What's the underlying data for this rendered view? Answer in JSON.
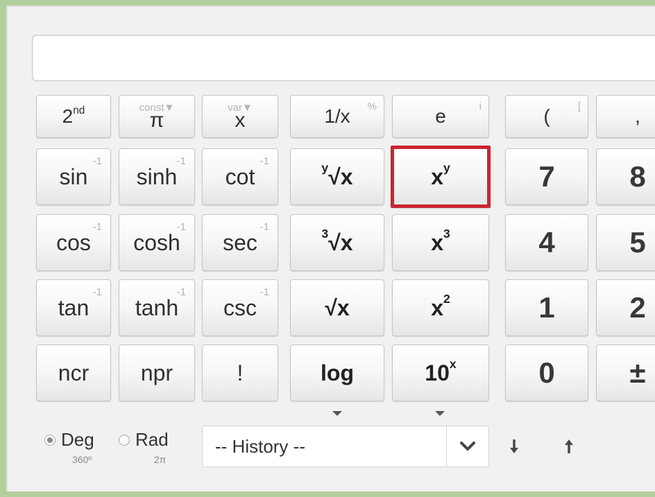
{
  "display": {
    "value": ""
  },
  "keys": {
    "second": {
      "label": "2",
      "sup": "nd"
    },
    "const": {
      "hint": "const▼",
      "label": "π"
    },
    "var": {
      "hint": "var▼",
      "label": "x"
    },
    "reciprocal": {
      "label": "1/x",
      "hint": "%"
    },
    "e": {
      "label": "e",
      "hint": "i"
    },
    "paren_open": {
      "label": "(",
      "hint": "["
    },
    "comma": {
      "label": ","
    },
    "sin": {
      "label": "sin",
      "hint": "-1"
    },
    "sinh": {
      "label": "sinh",
      "hint": "-1"
    },
    "cot": {
      "label": "cot",
      "hint": "-1"
    },
    "yroot": {
      "pre": "y",
      "label": "√x"
    },
    "xpowy": {
      "label": "x",
      "sup": "y"
    },
    "n7": "7",
    "n8": "8",
    "cos": {
      "label": "cos",
      "hint": "-1"
    },
    "cosh": {
      "label": "cosh",
      "hint": "-1"
    },
    "sec": {
      "label": "sec",
      "hint": "-1"
    },
    "cuberoot": {
      "pre": "3",
      "label": "√x"
    },
    "cube": {
      "label": "x",
      "sup": "3"
    },
    "n4": "4",
    "n5": "5",
    "tan": {
      "label": "tan",
      "hint": "-1"
    },
    "tanh": {
      "label": "tanh",
      "hint": "-1"
    },
    "csc": {
      "label": "csc",
      "hint": "-1"
    },
    "sqrt": {
      "label": "√x"
    },
    "square": {
      "label": "x",
      "sup": "2"
    },
    "n1": "1",
    "n2": "2",
    "ncr": "ncr",
    "npr": "npr",
    "fact": "!",
    "log": "log",
    "pow10": {
      "label": "10",
      "sup": "x"
    },
    "n0": "0",
    "plusminus": "±"
  },
  "angle": {
    "deg": {
      "label": "Deg",
      "sub": "360º",
      "selected": true
    },
    "rad": {
      "label": "Rad",
      "sub": "2π",
      "selected": false
    }
  },
  "history": {
    "value": "-- History --"
  },
  "icons": {
    "history_toggle": "chevron-down-icon",
    "down": "arrow-down-icon",
    "up": "arrow-up-icon"
  },
  "colors": {
    "highlight": "#cc2430",
    "frame": "#b3cf9b"
  }
}
